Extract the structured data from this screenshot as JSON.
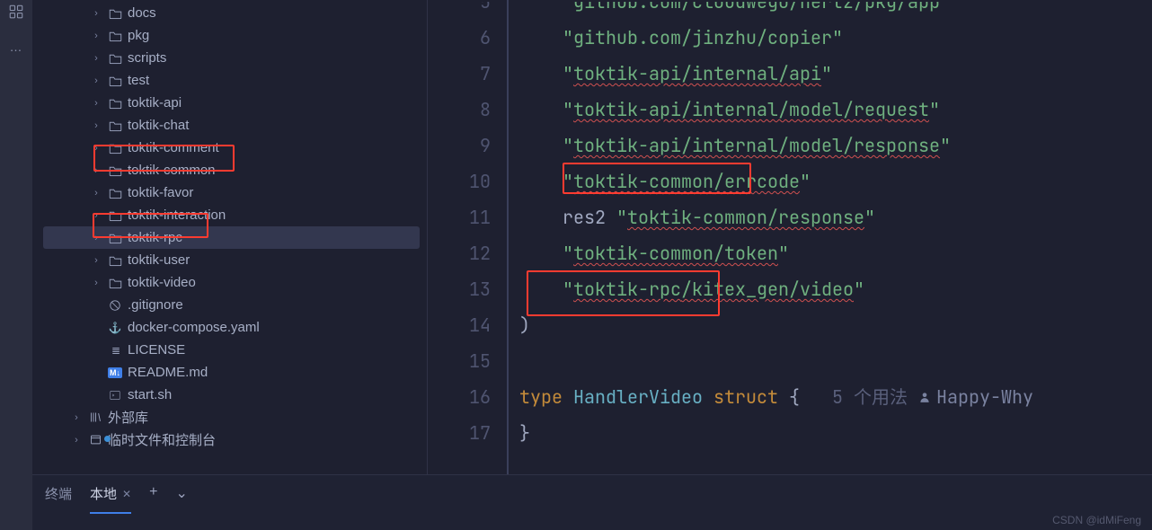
{
  "sidebar_icons": {
    "apps": "apps-icon",
    "more": "…"
  },
  "tree": {
    "items": [
      {
        "label": "docs",
        "type": "folder",
        "chev": true,
        "indent": 1
      },
      {
        "label": "pkg",
        "type": "folder",
        "chev": true,
        "indent": 1
      },
      {
        "label": "scripts",
        "type": "folder",
        "chev": true,
        "indent": 1
      },
      {
        "label": "test",
        "type": "folder",
        "chev": true,
        "indent": 1
      },
      {
        "label": "toktik-api",
        "type": "folder",
        "chev": true,
        "indent": 1
      },
      {
        "label": "toktik-chat",
        "type": "folder",
        "chev": true,
        "indent": 1
      },
      {
        "label": "toktik-comment",
        "type": "folder",
        "chev": true,
        "indent": 1
      },
      {
        "label": "toktik-common",
        "type": "folder",
        "chev": true,
        "indent": 1,
        "highlight": true
      },
      {
        "label": "toktik-favor",
        "type": "folder",
        "chev": true,
        "indent": 1
      },
      {
        "label": "toktik-interaction",
        "type": "folder",
        "chev": true,
        "indent": 1
      },
      {
        "label": "toktik-rpc",
        "type": "folder",
        "chev": true,
        "indent": 1,
        "highlight": true,
        "selected": true
      },
      {
        "label": "toktik-user",
        "type": "folder",
        "chev": true,
        "indent": 1
      },
      {
        "label": "toktik-video",
        "type": "folder",
        "chev": true,
        "indent": 1
      },
      {
        "label": ".gitignore",
        "type": "gitignore",
        "chev": false,
        "indent": 1
      },
      {
        "label": "docker-compose.yaml",
        "type": "yaml",
        "chev": false,
        "indent": 1
      },
      {
        "label": "LICENSE",
        "type": "license",
        "chev": false,
        "indent": 1
      },
      {
        "label": "README.md",
        "type": "md",
        "chev": false,
        "indent": 1
      },
      {
        "label": "start.sh",
        "type": "sh",
        "chev": false,
        "indent": 1
      }
    ],
    "external_lib": "外部库",
    "scratches": "临时文件和控制台"
  },
  "code": {
    "lines": [
      {
        "n": 5,
        "tokens": [
          {
            "t": "    ",
            "c": ""
          },
          {
            "t": "\"github.com/cloudwego/hertz/pkg/app\"",
            "c": "s-str",
            "cut": true
          }
        ]
      },
      {
        "n": 6,
        "tokens": [
          {
            "t": "    ",
            "c": ""
          },
          {
            "t": "\"github.com/jinzhu/copier\"",
            "c": "s-str"
          }
        ]
      },
      {
        "n": 7,
        "tokens": [
          {
            "t": "    ",
            "c": ""
          },
          {
            "t": "\"",
            "c": "s-str"
          },
          {
            "t": "toktik-api/internal/api",
            "c": "s-str underline-red"
          },
          {
            "t": "\"",
            "c": "s-str"
          }
        ]
      },
      {
        "n": 8,
        "tokens": [
          {
            "t": "    ",
            "c": ""
          },
          {
            "t": "\"",
            "c": "s-str"
          },
          {
            "t": "toktik-api/internal/model/request",
            "c": "s-str underline-red"
          },
          {
            "t": "\"",
            "c": "s-str"
          }
        ]
      },
      {
        "n": 9,
        "tokens": [
          {
            "t": "    ",
            "c": ""
          },
          {
            "t": "\"",
            "c": "s-str"
          },
          {
            "t": "toktik-api/internal/model/response",
            "c": "s-str underline-red"
          },
          {
            "t": "\"",
            "c": "s-str"
          }
        ]
      },
      {
        "n": 10,
        "tokens": [
          {
            "t": "    ",
            "c": ""
          },
          {
            "t": "\"",
            "c": "s-str"
          },
          {
            "t": "toktik-common",
            "c": "s-str underline-red",
            "box_left": true
          },
          {
            "t": "/errcode",
            "c": "s-str underline-red"
          },
          {
            "t": "\"",
            "c": "s-str"
          }
        ]
      },
      {
        "n": 11,
        "tokens": [
          {
            "t": "    res2 ",
            "c": "s-punc"
          },
          {
            "t": "\"",
            "c": "s-str"
          },
          {
            "t": "toktik-common/response",
            "c": "s-str underline-red"
          },
          {
            "t": "\"",
            "c": "s-str"
          }
        ]
      },
      {
        "n": 12,
        "tokens": [
          {
            "t": "    ",
            "c": ""
          },
          {
            "t": "\"",
            "c": "s-str"
          },
          {
            "t": "toktik-common/token",
            "c": "s-str underline-red"
          },
          {
            "t": "\"",
            "c": "s-str"
          }
        ]
      },
      {
        "n": 13,
        "tokens": [
          {
            "t": "    ",
            "c": ""
          },
          {
            "t": "\"",
            "c": "s-str"
          },
          {
            "t": "toktik-rpc",
            "c": "s-str underline-red",
            "box_left": true
          },
          {
            "t": "/kitex_gen/video",
            "c": "s-str underline-red"
          },
          {
            "t": "\"",
            "c": "s-str"
          }
        ]
      },
      {
        "n": 14,
        "tokens": [
          {
            "t": ")",
            "c": "s-punc"
          }
        ]
      },
      {
        "n": 15,
        "tokens": []
      },
      {
        "n": 16,
        "tokens": [
          {
            "t": "type ",
            "c": "s-kw"
          },
          {
            "t": "HandlerVideo ",
            "c": "s-type"
          },
          {
            "t": "struct ",
            "c": "s-kw"
          },
          {
            "t": "{",
            "c": "s-punc"
          }
        ],
        "usages": "5 个用法",
        "author": "Happy-Why"
      },
      {
        "n": 17,
        "tokens": [
          {
            "t": "}",
            "c": "s-punc"
          }
        ]
      }
    ]
  },
  "terminal": {
    "title": "终端",
    "tabs": [
      {
        "label": "本地",
        "active": true
      }
    ],
    "plus": "+",
    "chev": "⌄"
  },
  "watermark": "CSDN @idMiFeng"
}
